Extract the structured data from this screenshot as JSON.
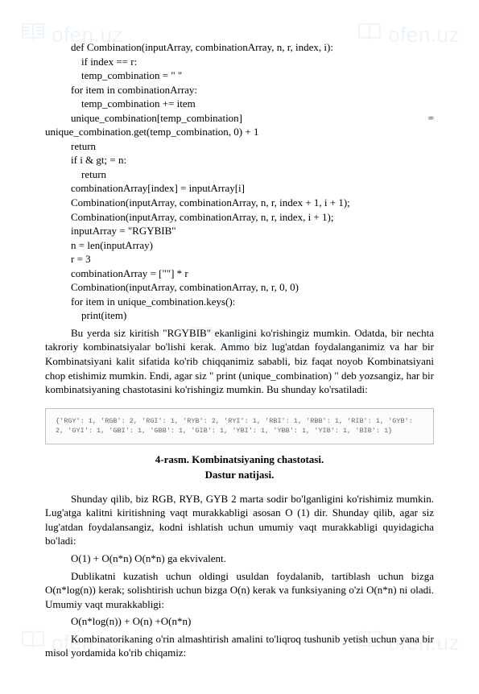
{
  "watermark": {
    "text": "ofen.uz"
  },
  "code": {
    "l1": "def Combination(inputArray, combinationArray, n, r, index, i):",
    "l2": "    if index == r:",
    "l3": "    temp_combination = \" \"",
    "l4": "for item in combinationArray:",
    "l5": "    temp_combination += item",
    "l6_left": "unique_combination[temp_combination]",
    "l6_right": "=",
    "l7": "unique_combination.get(temp_combination, 0) + 1",
    "l8": "return",
    "l9": "if i & gt; = n:",
    "l10": "    return",
    "l11": "combinationArray[index] = inputArray[i]",
    "l12": "Combination(inputArray, combinationArray, n, r, index + 1, i + 1);",
    "l13": "Combination(inputArray, combinationArray, n, r, index, i + 1);",
    "l14": "inputArray = \"RGYBIB\"",
    "l15": "n = len(inputArray)",
    "l16": "r = 3",
    "l17": "combinationArray = [\"\"] * r",
    "l18": "Combination(inputArray, combinationArray, n, r, 0, 0)",
    "l19": "for item in unique_combination.keys():",
    "l20": "    print(item)"
  },
  "para1": "Bu yerda siz kiritish \"RGYBIB\" ekanligini ko'rishingiz mumkin. Odatda, bir nechta takroriy kombinatsiyalar bo'lishi kerak. Ammo biz lug'atdan foydalanganimiz va har bir Kombinatsiyani kalit sifatida ko'rib chiqqanimiz sababli, biz faqat noyob Kombinatsiyani chop etishimiz mumkin. Endi, agar siz \" print (unique_combination) \" deb yozsangiz, har bir kombinatsiyaning chastotasini ko'rishingiz mumkin. Bu shunday ko'rsatiladi:",
  "boxed": "{'RGY': 1, 'RGB': 2, 'RGI': 1, 'RYB': 2, 'RYI': 1, 'RBI': 1, 'RBB': 1, 'RIB': 1, 'GYB': 2, 'GYI': 1, 'GBI': 1, 'GBB': 1, 'GIB': 1, 'YBI': 1, 'YBB': 1, 'YIB': 1, 'BIB': 1}",
  "caption_line1": "4-rasm. Kombinatsiyaning chastotasi.",
  "caption_line2": "Dastur natijasi.",
  "para2": "Shunday qilib, biz RGB, RYB, GYB 2 marta sodir bo'lganligini ko'rishimiz mumkin. Lug'atga kalitni kiritishning vaqt murakkabligi asosan O (1) dir. Shunday qilib, agar siz lug'atdan foydalansangiz, kodni ishlatish uchun umumiy vaqt murakkabligi quyidagicha bo'ladi:",
  "formula1": "O(1) + O(n*n) O(n*n) ga ekvivalent.",
  "para3": "Dublikatni kuzatish uchun oldingi usuldan foydalanib, tartiblash uchun bizga O(n*log(n)) kerak; solishtirish uchun bizga O(n) kerak va funksiyaning o'zi O(n*n) ni oladi. Umumiy vaqt murakkabligi:",
  "formula2": "O(n*log(n)) + O(n) +O(n*n)",
  "para4": "Kombinatorikaning o'rin almashtirish amalini to'liqroq tushunib yetish uchun yana bir misol yordamida ko'rib chiqamiz:"
}
